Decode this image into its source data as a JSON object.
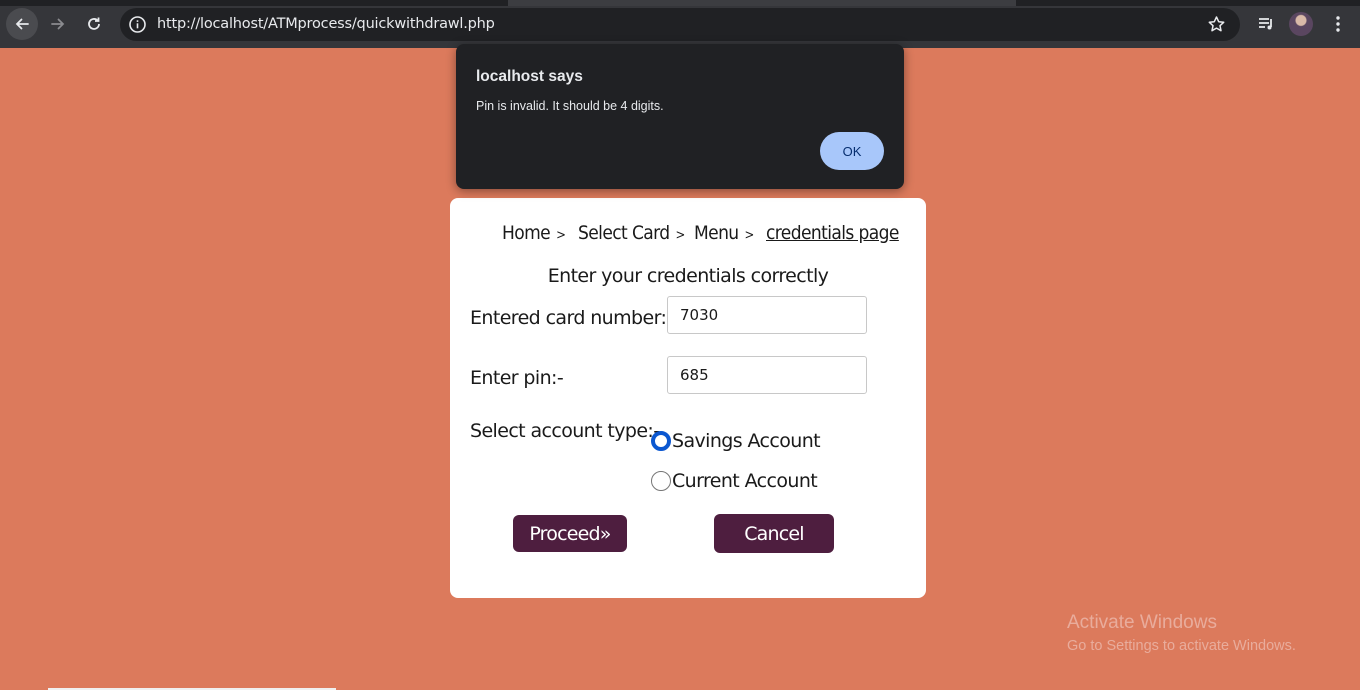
{
  "browser": {
    "url": "http://localhost/ATMprocess/quickwithdrawl.php",
    "icons": [
      "back-arrow-icon",
      "forward-arrow-icon",
      "reload-icon",
      "site-info-icon",
      "bookmark-star-icon",
      "media-control-icon",
      "profile-avatar",
      "kebab-menu-icon"
    ]
  },
  "alert": {
    "title": "localhost says",
    "message": "Pin is invalid. It should be 4 digits.",
    "ok_label": "OK"
  },
  "breadcrumb": {
    "items": [
      {
        "label": "Home",
        "sep": ">"
      },
      {
        "label": "Select Card",
        "sep": ">"
      },
      {
        "label": "Menu",
        "sep": ">"
      },
      {
        "label": "credentials page",
        "sep": ""
      }
    ]
  },
  "form": {
    "heading": "Enter your credentials correctly",
    "card_label": "Entered card number:-",
    "card_value": "7030",
    "pin_label": "Enter pin:-",
    "pin_value": "685",
    "account_label": "Select account type:-",
    "account_options": [
      {
        "label": "Savings Account",
        "checked": true
      },
      {
        "label": "Current Account",
        "checked": false
      }
    ],
    "proceed_label": "Proceed»",
    "cancel_label": "Cancel"
  },
  "watermark": {
    "title": "Activate Windows",
    "subtitle": "Go to Settings to activate Windows."
  },
  "colors": {
    "page_background": "#dc7a5c",
    "button_background": "#4e1e3f",
    "alert_ok_background": "#a8c7fa",
    "radio_accent": "#0b57d0"
  }
}
